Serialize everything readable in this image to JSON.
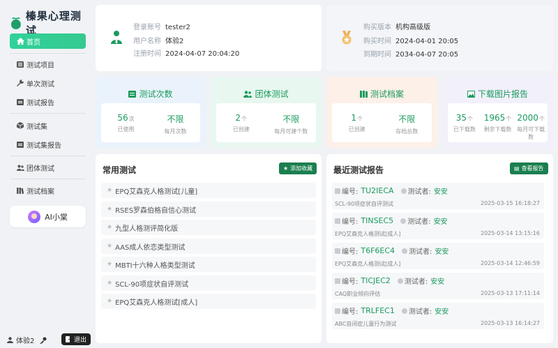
{
  "app": {
    "title": "榛果心理测试"
  },
  "sidebar": {
    "items": [
      {
        "label": "首页",
        "icon": "home-icon"
      },
      {
        "label": "测试项目",
        "icon": "list-icon"
      },
      {
        "label": "单次测试",
        "icon": "wrench-icon"
      },
      {
        "label": "测试报告",
        "icon": "report-icon"
      },
      {
        "label": "测试集",
        "icon": "cube-icon"
      },
      {
        "label": "测试集报告",
        "icon": "report-icon"
      },
      {
        "label": "团体测试",
        "icon": "group-icon"
      },
      {
        "label": "测试档案",
        "icon": "archive-icon"
      }
    ],
    "ai_label": "AI小棠",
    "user_name": "体验2",
    "logout_label": "退出"
  },
  "account": {
    "login_label": "登录账号",
    "login_value": "tester2",
    "name_label": "用户名称",
    "name_value": "体验2",
    "reg_label": "注册时间",
    "reg_value": "2024-04-07 20:04:20"
  },
  "subscription": {
    "version_label": "购买版本",
    "version_value": "机构高级版",
    "buy_label": "购买时间",
    "buy_value": "2024-04-01 20:05",
    "expire_label": "到期时间",
    "expire_value": "2034-04-07 20:05"
  },
  "stats": [
    {
      "title": "测试次数",
      "icon": "test-count-icon",
      "bg": "#eaf3fc",
      "color": "#1a9a5e",
      "a_val": "56",
      "a_unit": "次",
      "a_sub": "已使用",
      "b_val": "不限",
      "b_sub": "每月次数"
    },
    {
      "title": "团体测试",
      "icon": "group-icon",
      "bg": "#e8f7ef",
      "color": "#1a9a5e",
      "a_val": "2",
      "a_unit": "个",
      "a_sub": "已创建",
      "b_val": "不限",
      "b_sub": "每月可建个数"
    },
    {
      "title": "测试档案",
      "icon": "archive-icon",
      "bg": "#fdf0e8",
      "color": "#1a9a5e",
      "a_val": "1",
      "a_unit": "个",
      "a_sub": "已创建",
      "b_val": "不限",
      "b_sub": "存档总数"
    },
    {
      "title": "下载图片报告",
      "icon": "image-icon",
      "bg": "#f1f0fb",
      "color": "#1a9a5e",
      "a_val": "35",
      "a_unit": "个",
      "a_sub": "已下载数",
      "b_val": "1965",
      "b_unit": "个",
      "b_sub": "剩余下载数",
      "c_val": "2000",
      "c_unit": "个",
      "c_sub": "每月可下载数"
    }
  ],
  "common_tests": {
    "title": "常用测试",
    "add_label": "添加收藏",
    "items": [
      "EPQ艾森克人格测试[儿童]",
      "RSES罗森伯格自信心测试",
      "九型人格测评简化版",
      "AAS成人依恋类型测试",
      "MBTI十六种人格类型测试",
      "SCL-90项症状自评测试",
      "EPQ艾森克人格测试[成人]"
    ]
  },
  "recent_reports": {
    "title": "最近测试报告",
    "view_label": "查看报告",
    "code_label": "编号:",
    "tester_label": "测试者:",
    "items": [
      {
        "code": "TU2IECA",
        "tester": "安安",
        "test": "SCL-90项症状自评测试",
        "date": "2025-03-15 16:18:27"
      },
      {
        "code": "TINSEC5",
        "tester": "安安",
        "test": "EPQ艾森克人格测试[成人]",
        "date": "2025-03-14 13:15:16"
      },
      {
        "code": "T6F6EC4",
        "tester": "安安",
        "test": "EPQ艾森克人格测试[成人]",
        "date": "2025-03-14 12:46:59"
      },
      {
        "code": "TICJEC2",
        "tester": "安安",
        "test": "CAQ职业倾向评估",
        "date": "2025-03-13 17:11:14"
      },
      {
        "code": "TRLFEC1",
        "tester": "安安",
        "test": "ABC自闭症儿童行为测试",
        "date": "2025-03-13 16:14:27"
      }
    ]
  },
  "colors": {
    "accent": "#2fd29b",
    "green": "#1a9a5e",
    "dark_green": "#1a7f4f"
  }
}
